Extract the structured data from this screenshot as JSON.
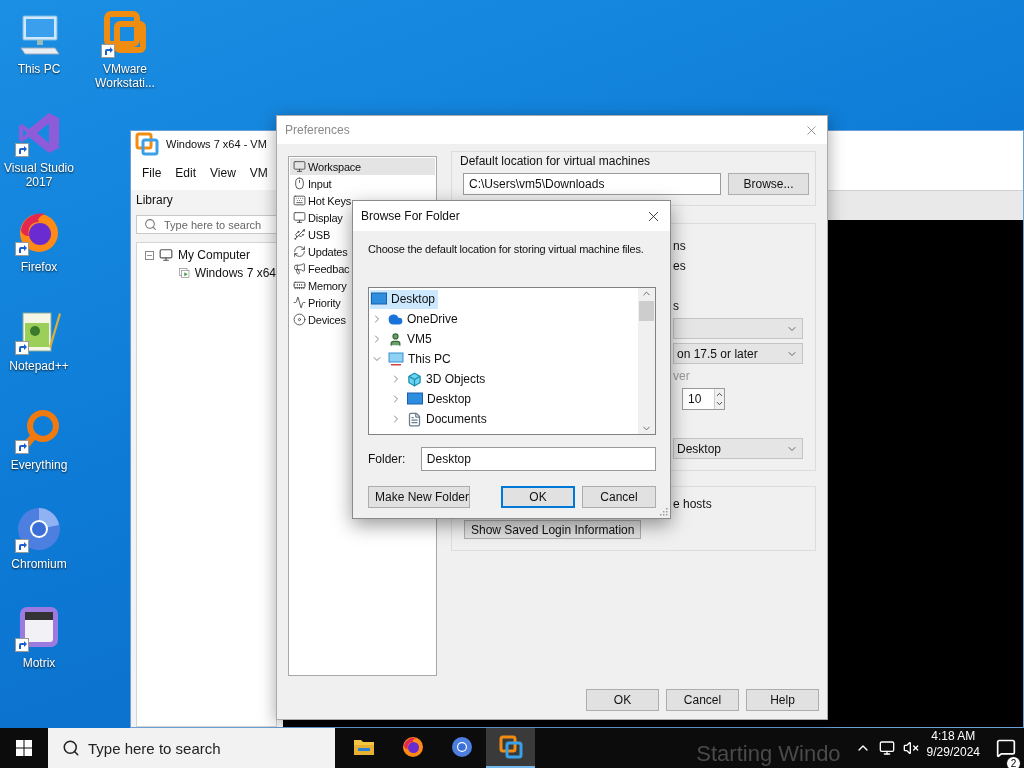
{
  "desktop": {
    "columns": [
      [
        {
          "label": "This PC",
          "kind": "computer",
          "shortcut": false
        },
        {
          "label": "Visual Studio 2017",
          "kind": "visualstudio",
          "shortcut": true
        },
        {
          "label": "Firefox",
          "kind": "firefox",
          "shortcut": true
        },
        {
          "label": "Notepad++",
          "kind": "notepad",
          "shortcut": true
        },
        {
          "label": "Everything",
          "kind": "everything",
          "shortcut": true
        },
        {
          "label": "Chromium",
          "kind": "chromium",
          "shortcut": true
        },
        {
          "label": "Motrix",
          "kind": "motrix",
          "shortcut": true
        }
      ],
      [
        {
          "label": "VMware Workstati...",
          "kind": "vmware",
          "shortcut": true
        }
      ]
    ]
  },
  "vmware_window": {
    "title": "Windows 7 x64 - VM",
    "menu": [
      "File",
      "Edit",
      "View",
      "VM"
    ],
    "library": {
      "title": "Library",
      "search": {
        "placeholder": "Type here to search"
      },
      "tree": [
        {
          "label": "My Computer",
          "expanded": true,
          "children": [
            {
              "label": "Windows 7 x64"
            }
          ]
        }
      ]
    }
  },
  "preferences": {
    "title": "Preferences",
    "categories": [
      {
        "label": "Workspace",
        "kind": "workspace",
        "selected": true
      },
      {
        "label": "Input",
        "kind": "input",
        "selected": false
      },
      {
        "label": "Hot Keys",
        "kind": "hotkeys",
        "selected": false
      },
      {
        "label": "Display",
        "kind": "display",
        "selected": false
      },
      {
        "label": "USB",
        "kind": "usb",
        "selected": false
      },
      {
        "label": "Updates",
        "kind": "updates",
        "selected": false
      },
      {
        "label": "Feedbac",
        "kind": "feedback",
        "selected": false
      },
      {
        "label": "Memory",
        "kind": "memory",
        "selected": false
      },
      {
        "label": "Priority",
        "kind": "priority",
        "selected": false
      },
      {
        "label": "Devices",
        "kind": "devices",
        "selected": false
      }
    ],
    "default_location": {
      "label": "Default location for virtual machines",
      "value": "C:\\Users\\vm5\\Downloads",
      "button": "Browse..."
    },
    "visible_fragments": [
      {
        "kind": "text",
        "text": "ns",
        "disabled": false
      },
      {
        "kind": "text",
        "text": "es",
        "disabled": false
      },
      {
        "kind": "text",
        "text": "s",
        "disabled": false
      },
      {
        "kind": "dropdown"
      },
      {
        "kind": "dropdown",
        "text": "on 17.5 or later"
      },
      {
        "kind": "text",
        "text": "ver",
        "disabled": true
      },
      {
        "kind": "spinner",
        "text": "10"
      },
      {
        "kind": "dropdown",
        "text": "Desktop"
      }
    ],
    "hosts_fragment": "e hosts",
    "login_button": "Show Saved Login Information",
    "buttons": [
      "OK",
      "Cancel",
      "Help"
    ]
  },
  "browse_dialog": {
    "title": "Browse For Folder",
    "description": "Choose the default location for storing virtual machine files.",
    "tree": [
      {
        "label": "Desktop",
        "kind": "desktop",
        "selected": true,
        "children": [
          {
            "label": "OneDrive",
            "kind": "onedrive",
            "expanded": false,
            "selected": false
          },
          {
            "label": "VM5",
            "kind": "user",
            "expanded": false,
            "selected": false
          },
          {
            "label": "This PC",
            "kind": "pc",
            "expanded": true,
            "selected": false,
            "children": [
              {
                "label": "3D Objects",
                "kind": "objects3d",
                "expanded": false,
                "selected": false
              },
              {
                "label": "Desktop",
                "kind": "desktop",
                "expanded": false,
                "selected": false
              },
              {
                "label": "Documents",
                "kind": "documents",
                "expanded": false,
                "selected": false
              }
            ]
          }
        ]
      }
    ],
    "folder_label": "Folder:",
    "folder_value": "Desktop",
    "buttons": [
      {
        "label": "Make New Folder",
        "default": false
      },
      {
        "label": "OK",
        "default": true
      },
      {
        "label": "Cancel",
        "default": false
      }
    ]
  },
  "taskbar": {
    "search": {
      "placeholder": "Type here to search"
    },
    "apps": [
      {
        "kind": "explorer",
        "active": false
      },
      {
        "kind": "firefox",
        "active": false
      },
      {
        "kind": "chromium",
        "active": false
      },
      {
        "kind": "vmware",
        "active": true
      }
    ],
    "vm_status_text": "Starting Windo",
    "clock": {
      "time": "4:18 AM",
      "date": "9/29/2024"
    },
    "notifications": {
      "count": "2"
    }
  }
}
